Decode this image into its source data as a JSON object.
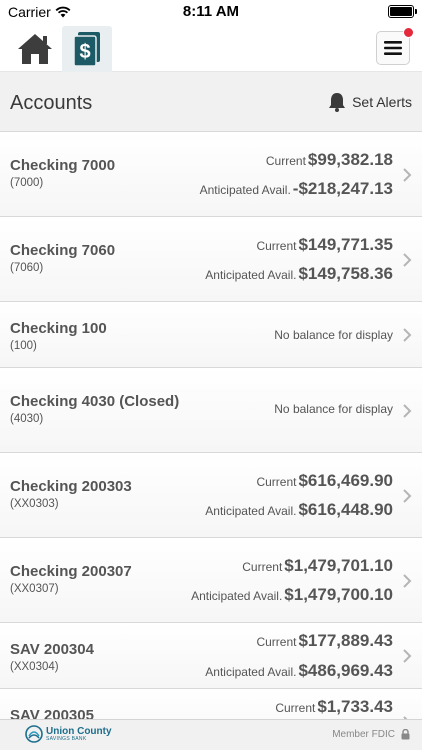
{
  "status_bar": {
    "carrier": "Carrier",
    "time": "8:11 AM"
  },
  "nav": {
    "home_icon": "home-icon",
    "accounts_icon": "dollar-card-icon",
    "menu_icon": "hamburger-menu-icon",
    "notification_color": "#e5283a",
    "accent_color": "#1c5a66"
  },
  "header": {
    "title": "Accounts",
    "set_alerts_label": "Set Alerts"
  },
  "accounts": [
    {
      "name": "Checking 7000",
      "number": "(7000)",
      "current_label": "Current",
      "current_value": "$99,382.18",
      "avail_label": "Anticipated Avail.",
      "avail_value": "-$218,247.13"
    },
    {
      "name": "Checking 7060",
      "number": "(7060)",
      "current_label": "Current",
      "current_value": "$149,771.35",
      "avail_label": "Anticipated Avail.",
      "avail_value": "$149,758.36"
    },
    {
      "name": "Checking 100",
      "number": "(100)",
      "no_balance": "No balance for display"
    },
    {
      "name": "Checking 4030 (Closed)",
      "number": "(4030)",
      "no_balance": "No balance for display"
    },
    {
      "name": "Checking 200303",
      "number": "(XX0303)",
      "current_label": "Current",
      "current_value": "$616,469.90",
      "avail_label": "Anticipated Avail.",
      "avail_value": "$616,448.90"
    },
    {
      "name": "Checking 200307",
      "number": "(XX0307)",
      "current_label": "Current",
      "current_value": "$1,479,701.10",
      "avail_label": "Anticipated Avail.",
      "avail_value": "$1,479,700.10"
    },
    {
      "name": "SAV 200304",
      "number": "(XX0304)",
      "current_label": "Current",
      "current_value": "$177,889.43",
      "avail_label": "Anticipated Avail.",
      "avail_value": "$486,969.43"
    },
    {
      "name": "SAV 200305",
      "current_label": "Current",
      "current_value": "$1,733.43"
    }
  ],
  "footer": {
    "logo_name": "Union County",
    "logo_sub": "SAVINGS BANK",
    "member_fdic": "Member FDIC",
    "lock_icon": "lock-icon"
  }
}
